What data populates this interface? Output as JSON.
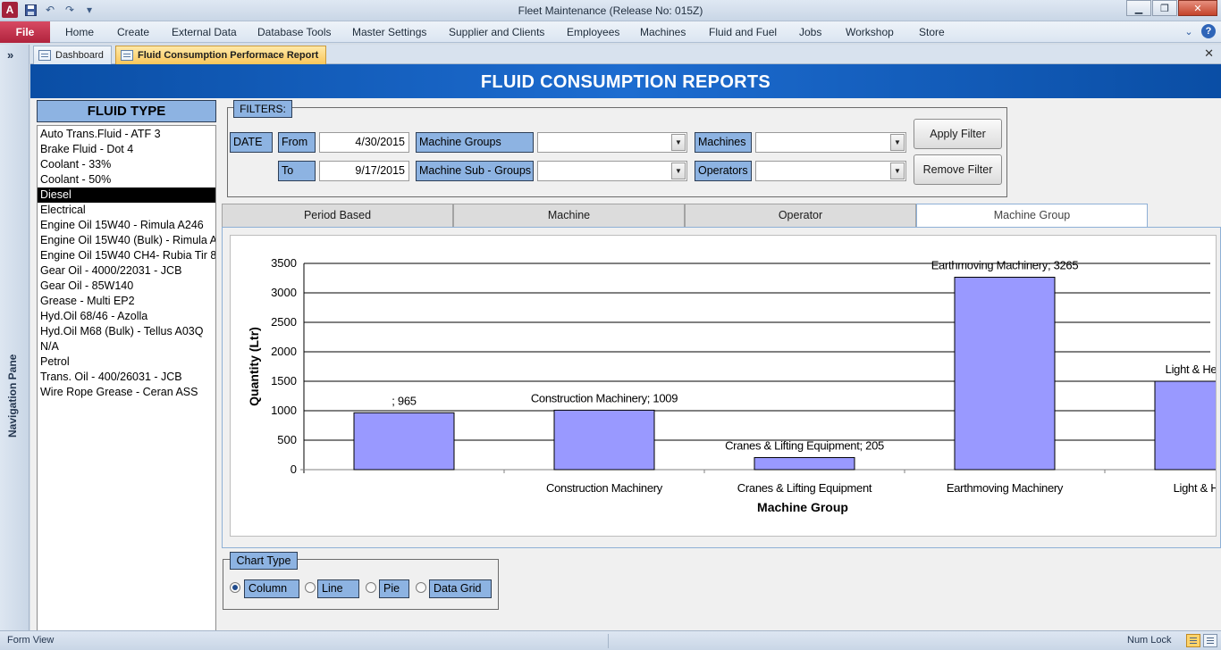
{
  "window": {
    "title": "Fleet Maintenance (Release No: 015Z)",
    "app_letter": "A"
  },
  "menu": {
    "file": "File",
    "items": [
      "Home",
      "Create",
      "External Data",
      "Database Tools",
      "Master Settings",
      "Supplier and Clients",
      "Employees",
      "Machines",
      "Fluid and Fuel",
      "Jobs",
      "Workshop",
      "Store"
    ]
  },
  "nav": {
    "toggle": "»",
    "label": "Navigation Pane"
  },
  "doc_tabs": [
    {
      "label": "Dashboard"
    },
    {
      "label": "Fluid Consumption Performace Report"
    }
  ],
  "header": {
    "title": "FLUID CONSUMPTION REPORTS"
  },
  "fluid_type": {
    "title": "FLUID TYPE",
    "selected": "Diesel",
    "items": [
      "Auto Trans.Fluid - ATF 3",
      "Brake Fluid - Dot 4",
      "Coolant - 33%",
      "Coolant - 50%",
      "Diesel",
      "Electrical",
      "Engine Oil 15W40 - Rimula A246",
      "Engine Oil 15W40 (Bulk) - Rimula A",
      "Engine Oil 15W40 CH4- Rubia Tir 8",
      "Gear Oil - 4000/22031 - JCB",
      "Gear Oil - 85W140",
      "Grease - Multi EP2",
      "Hyd.Oil 68/46 - Azolla",
      "Hyd.Oil M68 (Bulk) - Tellus A03Q",
      "N/A",
      "Petrol",
      "Trans. Oil - 400/26031 - JCB",
      "Wire Rope Grease - Ceran ASS"
    ]
  },
  "filters": {
    "legend": "FILTERS:",
    "date_label": "DATE",
    "from_label": "From",
    "from_value": "4/30/2015",
    "to_label": "To",
    "to_value": "9/17/2015",
    "machine_groups_label": "Machine Groups",
    "machine_sub_groups_label": "Machine Sub - Groups",
    "machines_label": "Machines",
    "operators_label": "Operators",
    "apply_button": "Apply Filter",
    "remove_button": "Remove Filter",
    "drop_glyph": "▼"
  },
  "chart_tabs": {
    "items": [
      "Period Based",
      "Machine",
      "Operator",
      "Machine Group"
    ],
    "active": "Machine Group"
  },
  "chart_data": {
    "type": "bar",
    "categories": [
      "",
      "Construction Machinery",
      "Cranes & Lifting Equipment",
      "Earthmoving Machinery",
      "Light & Heavy V"
    ],
    "values": [
      965,
      1009,
      205,
      3265,
      1500
    ],
    "data_labels": [
      "; 965",
      "Construction Machinery; 1009",
      "Cranes & Lifting Equipment; 205",
      "Earthmoving Machinery; 3265",
      "Light & Heavy V"
    ],
    "tick_labels": [
      "",
      "Construction Machinery",
      "Cranes & Lifting Equipment",
      "Earthmoving Machinery",
      "Light & Heav"
    ],
    "xlabel": "Machine Group",
    "ylabel": "Quantity (Ltr)",
    "ylim": [
      0,
      3500
    ],
    "yticks": [
      0,
      500,
      1000,
      1500,
      2000,
      2500,
      3000,
      3500
    ],
    "grid": true,
    "bar_color": "#9999ff"
  },
  "chart_type": {
    "legend": "Chart Type",
    "options": [
      "Column",
      "Line",
      "Pie",
      "Data Grid"
    ],
    "selected": "Column"
  },
  "status": {
    "left": "Form View",
    "right": "Num Lock"
  },
  "colors": {
    "header_blue": "#1560bf",
    "label_blue": "#8db3e2",
    "file_red": "#b0233d"
  }
}
